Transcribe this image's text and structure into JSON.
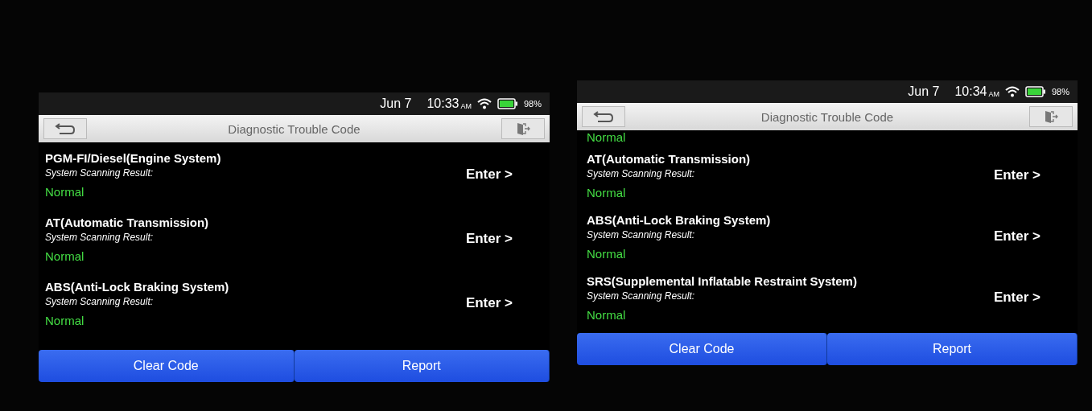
{
  "screens": [
    {
      "status": {
        "date": "Jun 7",
        "time": "10:33",
        "ampm": "AM",
        "battery": "98%"
      },
      "title": "Diagnostic Trouble Code",
      "systems": [
        {
          "name": "PGM-FI/Diesel(Engine System)",
          "label": "System Scanning Result:",
          "result": "Normal",
          "action": "Enter >"
        },
        {
          "name": "AT(Automatic Transmission)",
          "label": "System Scanning Result:",
          "result": "Normal",
          "action": "Enter >"
        },
        {
          "name": "ABS(Anti-Lock Braking System)",
          "label": "System Scanning Result:",
          "result": "Normal",
          "action": "Enter >"
        }
      ],
      "buttons": [
        "Clear Code",
        "Report"
      ]
    },
    {
      "status": {
        "date": "Jun 7",
        "time": "10:34",
        "ampm": "AM",
        "battery": "98%"
      },
      "title": "Diagnostic Trouble Code",
      "leading_result": "Normal",
      "systems": [
        {
          "name": "AT(Automatic Transmission)",
          "label": "System Scanning Result:",
          "result": "Normal",
          "action": "Enter >"
        },
        {
          "name": "ABS(Anti-Lock Braking System)",
          "label": "System Scanning Result:",
          "result": "Normal",
          "action": "Enter >"
        },
        {
          "name": "SRS(Supplemental Inflatable Restraint System)",
          "label": "System Scanning Result:",
          "result": "Normal",
          "action": "Enter >"
        }
      ],
      "buttons": [
        "Clear Code",
        "Report"
      ]
    }
  ]
}
